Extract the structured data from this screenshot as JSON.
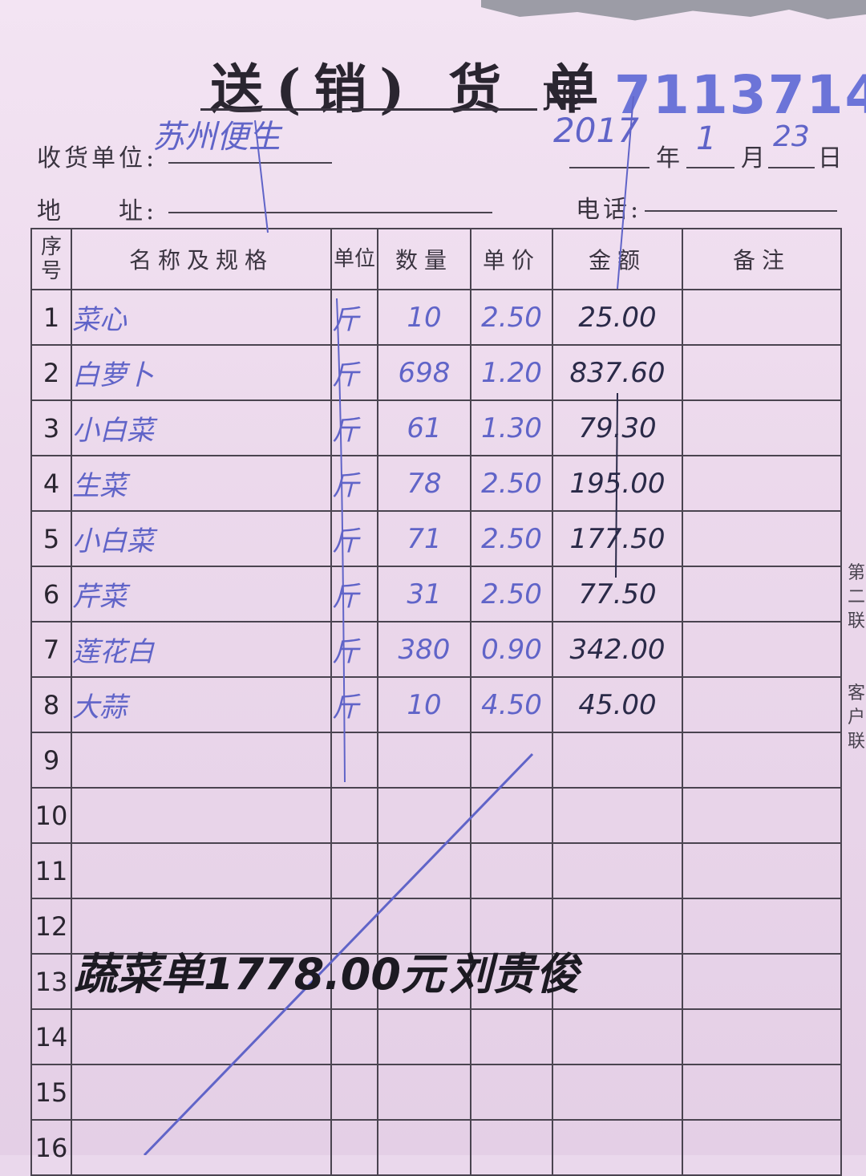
{
  "header": {
    "title": "送(销) 货 单",
    "number_mark": "№",
    "serial": "7113714"
  },
  "fields": {
    "recipient_label": "收货单位:",
    "recipient_value": "苏州便生",
    "address_label": "地　　址:",
    "phone_label": "电话:",
    "year_value": "2017",
    "year_label": "年",
    "month_value": "1",
    "month_label": "月",
    "day_value": "23",
    "day_label": "日"
  },
  "table": {
    "headers": {
      "seq": "序号",
      "name": "名称及规格",
      "unit": "单位",
      "qty": "数量",
      "price": "单价",
      "amount": "金额",
      "remark": "备注"
    },
    "rows": [
      {
        "seq": "1",
        "name": "菜心",
        "unit": "斤",
        "qty": "10",
        "price": "2.50",
        "amount": "25.00"
      },
      {
        "seq": "2",
        "name": "白萝卜",
        "unit": "斤",
        "qty": "698",
        "price": "1.20",
        "amount": "837.60"
      },
      {
        "seq": "3",
        "name": "小白菜",
        "unit": "斤",
        "qty": "61",
        "price": "1.30",
        "amount": "79.30"
      },
      {
        "seq": "4",
        "name": "生菜",
        "unit": "斤",
        "qty": "78",
        "price": "2.50",
        "amount": "195.00"
      },
      {
        "seq": "5",
        "name": "小白菜",
        "unit": "斤",
        "qty": "71",
        "price": "2.50",
        "amount": "177.50"
      },
      {
        "seq": "6",
        "name": "芹菜",
        "unit": "斤",
        "qty": "31",
        "price": "2.50",
        "amount": "77.50"
      },
      {
        "seq": "7",
        "name": "莲花白",
        "unit": "斤",
        "qty": "380",
        "price": "0.90",
        "amount": "342.00"
      },
      {
        "seq": "8",
        "name": "大蒜",
        "unit": "斤",
        "qty": "10",
        "price": "4.50",
        "amount": "45.00"
      },
      {
        "seq": "9"
      },
      {
        "seq": "10"
      },
      {
        "seq": "11"
      },
      {
        "seq": "12"
      },
      {
        "seq": "13"
      },
      {
        "seq": "14"
      },
      {
        "seq": "15"
      },
      {
        "seq": "16"
      }
    ]
  },
  "total_note": "蔬菜单1778.00元",
  "signature": "刘贵俊",
  "side_text": {
    "copy": "第二联",
    "customer": "客户联"
  },
  "colors": {
    "paper": "#ecd9ec",
    "print_ink": "#3a3440",
    "blue_ink": "#6064c8",
    "serial_ink": "#6c74d8",
    "black_ink": "#1c1a22"
  }
}
